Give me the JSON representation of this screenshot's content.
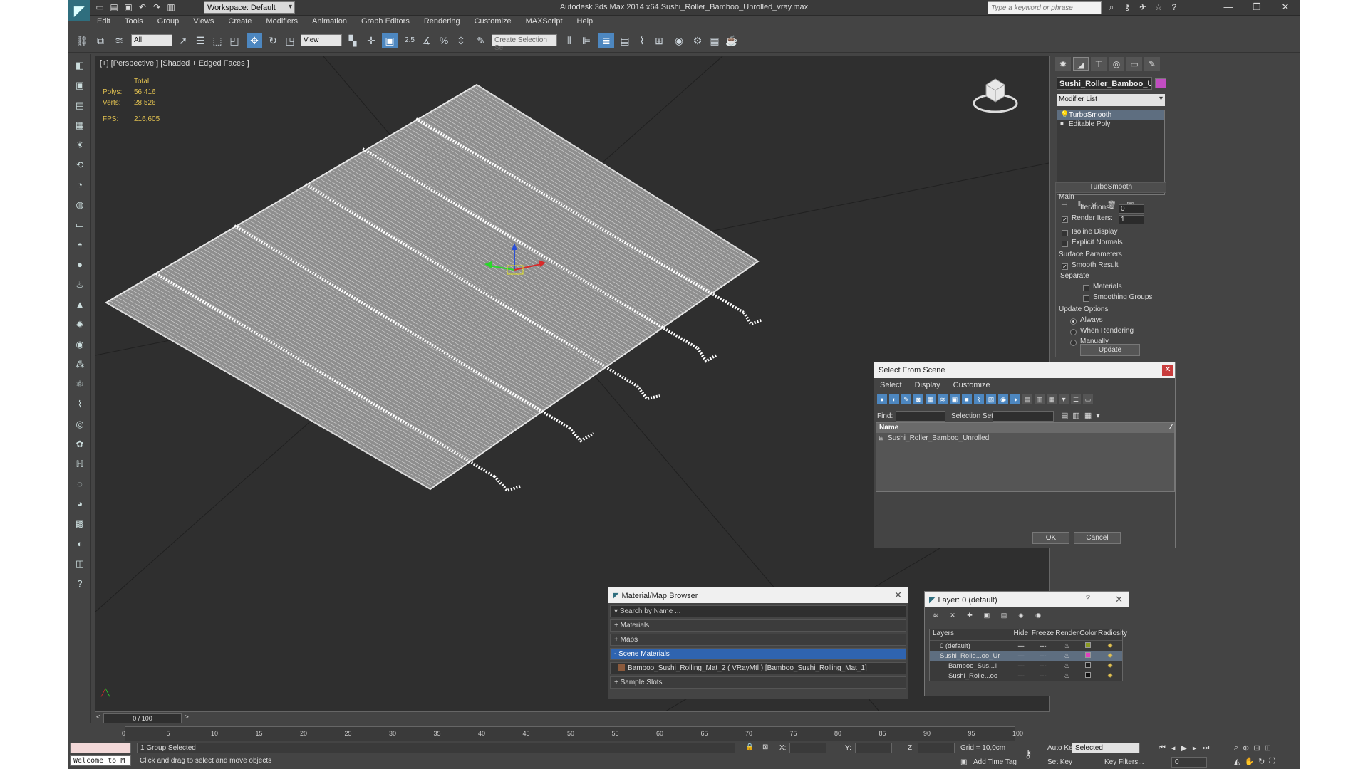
{
  "titlebar": {
    "workspace": "Workspace: Default",
    "app_title": "Autodesk 3ds Max  2014 x64     Sushi_Roller_Bamboo_Unrolled_vray.max",
    "search_placeholder": "Type a keyword or phrase"
  },
  "menubar": [
    "Edit",
    "Tools",
    "Group",
    "Views",
    "Create",
    "Modifiers",
    "Animation",
    "Graph Editors",
    "Rendering",
    "Customize",
    "MAXScript",
    "Help"
  ],
  "toolbar": {
    "selection_filter": "All",
    "ref_coord": "View",
    "snap_label": "2.5",
    "selection_set_placeholder": "Create Selection Se"
  },
  "viewport": {
    "label": "[+] [Perspective ] [Shaded + Edged Faces ]",
    "stats": {
      "total_label": "Total",
      "polys_label": "Polys:",
      "polys_value": "56 416",
      "verts_label": "Verts:",
      "verts_value": "28 526",
      "fps_label": "FPS:",
      "fps_value": "216,605"
    }
  },
  "command_panel": {
    "object_name": "Sushi_Roller_Bamboo_Ur",
    "modifier_list": "Modifier List",
    "stack": [
      "TurboSmooth",
      "Editable Poly"
    ],
    "turbosmooth": {
      "title": "TurboSmooth",
      "main": "Main",
      "iterations_label": "Iterations:",
      "iterations_value": "0",
      "render_iters_label": "Render Iters:",
      "render_iters_value": "1",
      "isoline": "Isoline Display",
      "explicit_normals": "Explicit Normals",
      "surface_params": "Surface Parameters",
      "smooth_result": "Smooth Result",
      "separate": "Separate",
      "materials": "Materials",
      "smoothing_groups": "Smoothing Groups",
      "update_options": "Update Options",
      "always": "Always",
      "when_rendering": "When Rendering",
      "manually": "Manually",
      "update_button": "Update"
    }
  },
  "select_from_scene": {
    "title": "Select From Scene",
    "menu": [
      "Select",
      "Display",
      "Customize"
    ],
    "find_label": "Find:",
    "selection_set_label": "Selection Set:",
    "column_name": "Name",
    "items": [
      "Sushi_Roller_Bamboo_Unrolled"
    ],
    "ok": "OK",
    "cancel": "Cancel"
  },
  "material_browser": {
    "title": "Material/Map Browser",
    "search_placeholder": "Search by Name ...",
    "sections": [
      "+ Materials",
      "+ Maps",
      "- Scene Materials"
    ],
    "scene_material": "Bamboo_Sushi_Rolling_Mat_2 ( VRayMtl ) [Bamboo_Sushi_Rolling_Mat_1]",
    "sample_slots": "+ Sample Slots"
  },
  "layer_dialog": {
    "title": "Layer: 0 (default)",
    "help": "?",
    "columns": [
      "Layers",
      "Hide",
      "Freeze",
      "Render",
      "Color",
      "Radiosity"
    ],
    "rows": [
      {
        "name": "0 (default)",
        "color": "#8a9a20"
      },
      {
        "name": "Sushi_Rolle...oo_Ur",
        "color": "#e040c0"
      },
      {
        "name": "Bamboo_Sus...li",
        "color": "#202020"
      },
      {
        "name": "Sushi_Rolle...oo",
        "color": "#101010"
      }
    ]
  },
  "timeline": {
    "frame": "0 / 100",
    "ticks": [
      "0",
      "5",
      "10",
      "15",
      "20",
      "25",
      "30",
      "35",
      "40",
      "45",
      "50",
      "55",
      "60",
      "65",
      "70",
      "75",
      "80",
      "85",
      "90",
      "95",
      "100"
    ]
  },
  "statusbar": {
    "maxscript": "Welcome to M",
    "selection": "1 Group Selected",
    "prompt": "Click and drag to select and move objects",
    "x_label": "X:",
    "y_label": "Y:",
    "z_label": "Z:",
    "grid": "Grid = 10,0cm",
    "add_time_tag": "Add Time Tag",
    "auto_key": "Auto Key",
    "set_key": "Set Key",
    "key_mode": "Selected",
    "key_filters": "Key Filters...",
    "frame_value": "0"
  },
  "colors": {
    "accent": "#4d87c0",
    "viewport_bg": "#2f2f2f",
    "object_color": "#c24dc2",
    "stats": "#e0c050"
  }
}
